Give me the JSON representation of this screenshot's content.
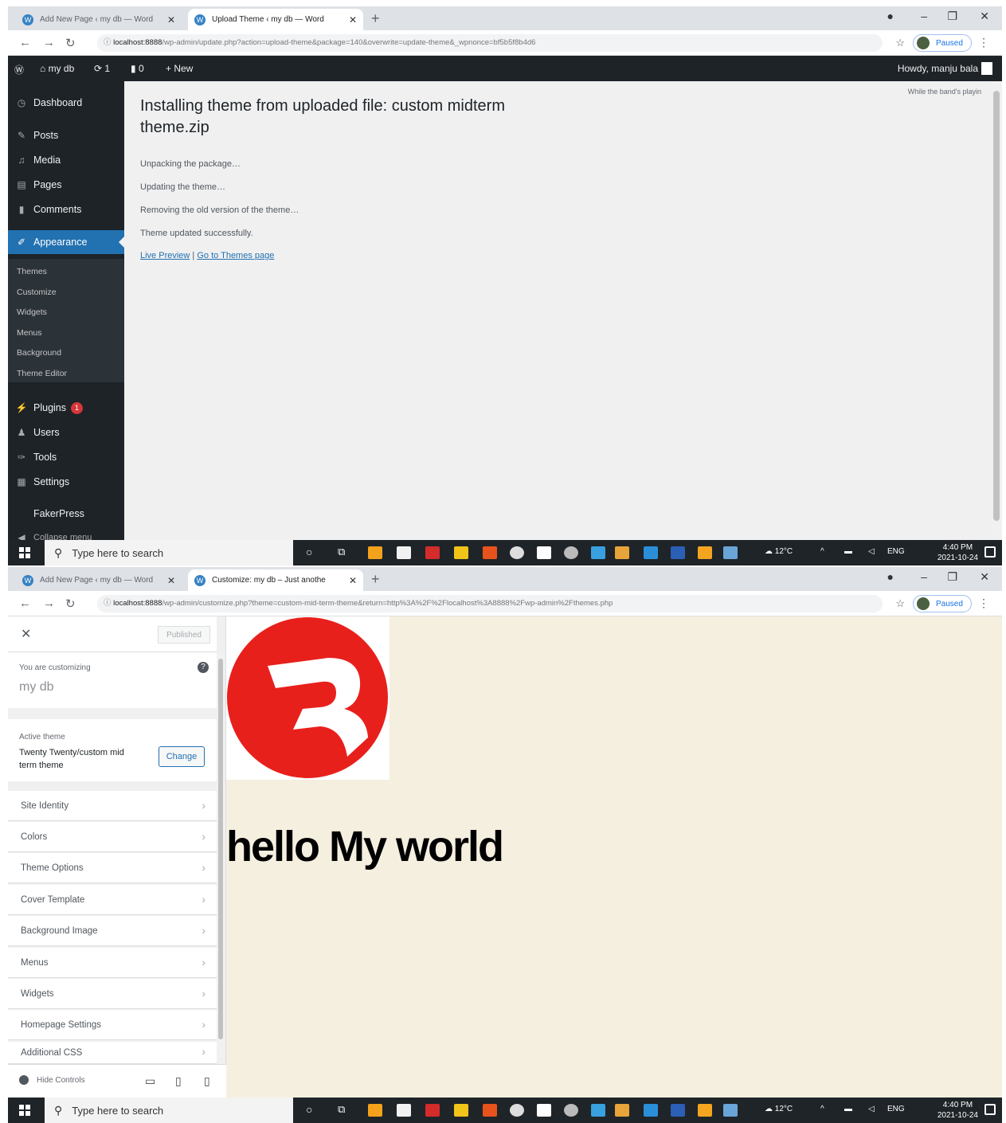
{
  "windows": [
    {
      "tabs": [
        "Add New Page ‹ my db — Word",
        "Upload Theme ‹ my db — Word"
      ],
      "url_host": "localhost:8888",
      "url_rest": "/wp-admin/update.php?action=upload-theme&package=140&overwrite=update-theme&_wpnonce=bf5b5f8b4d6",
      "profile": "Paused",
      "admin_bar": {
        "site": "my db",
        "updates": "1",
        "comments": "0",
        "new": "New",
        "howdy": "Howdy, manju bala"
      },
      "menu": {
        "dashboard": "Dashboard",
        "posts": "Posts",
        "media": "Media",
        "pages": "Pages",
        "comments": "Comments",
        "appearance": "Appearance",
        "plugins": "Plugins",
        "plugins_count": "1",
        "users": "Users",
        "tools": "Tools",
        "settings": "Settings",
        "fakerpress": "FakerPress",
        "collapse": "Collapse menu"
      },
      "submenu": [
        "Themes",
        "Customize",
        "Widgets",
        "Menus",
        "Background",
        "Theme Editor"
      ],
      "screen_options": "While the band's playin",
      "heading": "Installing theme from uploaded file: custom midterm theme.zip",
      "messages": [
        "Unpacking the package…",
        "Updating the theme…",
        "Removing the old version of the theme…",
        "Theme updated successfully."
      ],
      "link_preview": "Live Preview",
      "link_sep": " | ",
      "link_themes": "Go to Themes page"
    },
    {
      "tabs": [
        "Add New Page ‹ my db — Word",
        "Customize: my db – Just anothe"
      ],
      "url_host": "localhost:8888",
      "url_rest": "/wp-admin/customize.php?theme=custom-mid-term-theme&return=http%3A%2F%2Flocalhost%3A8888%2Fwp-admin%2Fthemes.php",
      "profile": "Paused",
      "customizer": {
        "published": "Published",
        "customizing_label": "You are customizing",
        "site_name": "my db",
        "active_theme_label": "Active theme",
        "theme_name": "Twenty Twenty/custom mid term theme",
        "change": "Change",
        "sections": [
          "Site Identity",
          "Colors",
          "Theme Options",
          "Cover Template",
          "Background Image",
          "Menus",
          "Widgets",
          "Homepage Settings",
          "Additional CSS"
        ],
        "hide_controls": "Hide Controls"
      },
      "preview_text": "hello My world",
      "logo_color": "#e8201c"
    }
  ],
  "taskbar": {
    "search_placeholder": "Type here to search",
    "temp": "12°C",
    "lang": "ENG",
    "time": "4:40 PM",
    "date": "2021-10-24"
  },
  "colors": {
    "admin_dark": "#1d2327",
    "accent": "#2271b1",
    "preview_bg": "#f5efe0"
  }
}
